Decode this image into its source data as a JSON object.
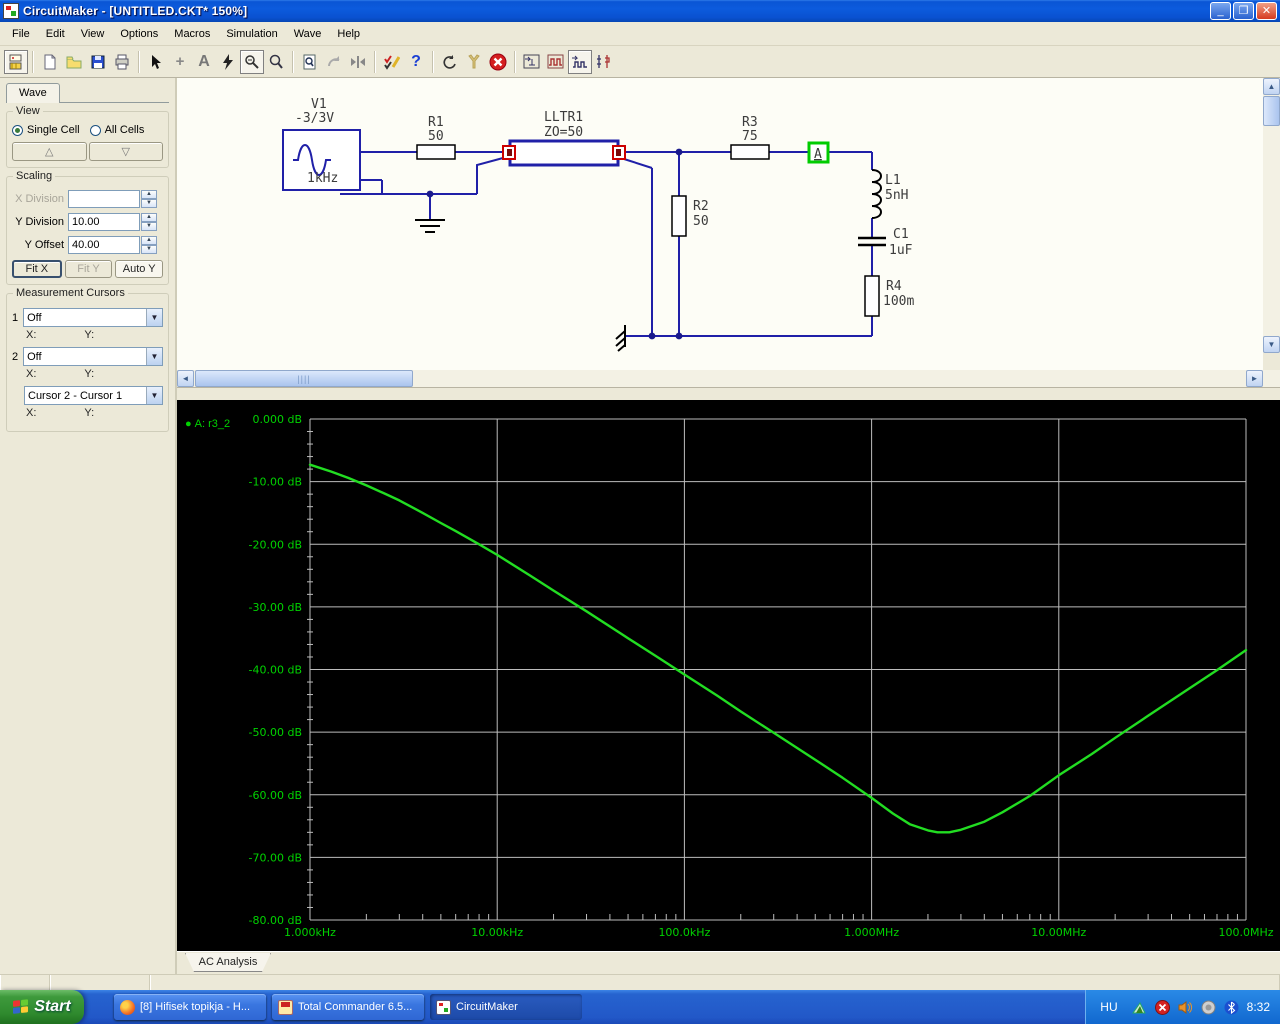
{
  "window": {
    "title": "CircuitMaker - [UNTITLED.CKT* 150%]"
  },
  "menubar": {
    "items": [
      "File",
      "Edit",
      "View",
      "Options",
      "Macros",
      "Simulation",
      "Wave",
      "Help"
    ]
  },
  "toolbar": {
    "icons": [
      "part-browser",
      "new-document",
      "open-file",
      "save-file",
      "print",
      "select-arrow",
      "wire-plus",
      "text-tool",
      "run-simulation",
      "probe-tool",
      "zoom-tool",
      "zoom-page",
      "rotate",
      "split-view",
      "edit-checks",
      "help",
      "undo",
      "utility-wrench",
      "stop-simulation",
      "wave-step",
      "wave-pulse",
      "wave-pulse-run",
      "wave-dual"
    ]
  },
  "wave_panel": {
    "tab_label": "Wave",
    "view": {
      "legend": "View",
      "single_cell": "Single Cell",
      "all_cells": "All Cells",
      "up_glyph": "△",
      "down_glyph": "▽"
    },
    "scaling": {
      "legend": "Scaling",
      "x_division_label": "X Division",
      "x_division_value": "",
      "y_division_label": "Y Division",
      "y_division_value": "10.00",
      "y_offset_label": "Y Offset",
      "y_offset_value": "40.00",
      "fit_x": "Fit X",
      "fit_y": "Fit Y",
      "auto_y": "Auto Y"
    },
    "cursors": {
      "legend": "Measurement Cursors",
      "cursor1_num": "1",
      "cursor1_value": "Off",
      "cursor2_num": "2",
      "cursor2_value": "Off",
      "diff_value": "Cursor 2 - Cursor 1",
      "x_label": "X:",
      "y_label": "Y:"
    }
  },
  "circuit": {
    "v1": {
      "name": "V1",
      "value": "-3/3V",
      "freq": "1kHz"
    },
    "r1": {
      "name": "R1",
      "value": "50"
    },
    "tline": {
      "name": "LLTR1",
      "value": "ZO=50"
    },
    "r2": {
      "name": "R2",
      "value": "50"
    },
    "r3": {
      "name": "R3",
      "value": "75"
    },
    "probe": {
      "label": "A"
    },
    "l1": {
      "name": "L1",
      "value": "5nH"
    },
    "c1": {
      "name": "C1",
      "value": "1uF"
    },
    "r4": {
      "name": "R4",
      "value": "100m"
    }
  },
  "plot": {
    "tab_label": "AC Analysis"
  },
  "chart_data": {
    "type": "line",
    "title": "AC Analysis - magnitude response at probe A (r3_2)",
    "x_scale": "log",
    "x_range_hz": [
      1000,
      100000000
    ],
    "y_range_db": [
      -80,
      0
    ],
    "grid": true,
    "axis_color": "#00d200",
    "grid_color": "#bdbdbd",
    "trace": {
      "name": "A: r3_2",
      "color": "#22dd22"
    },
    "x_ticks": [
      {
        "hz": 1000,
        "label": "1.000kHz"
      },
      {
        "hz": 10000,
        "label": "10.00kHz"
      },
      {
        "hz": 100000,
        "label": "100.0kHz"
      },
      {
        "hz": 1000000,
        "label": "1.000MHz"
      },
      {
        "hz": 10000000,
        "label": "10.00MHz"
      },
      {
        "hz": 100000000,
        "label": "100.0MHz"
      }
    ],
    "y_ticks": [
      {
        "db": 0,
        "label": "0.000 dB"
      },
      {
        "db": -10,
        "label": "-10.00 dB"
      },
      {
        "db": -20,
        "label": "-20.00 dB"
      },
      {
        "db": -30,
        "label": "-30.00 dB"
      },
      {
        "db": -40,
        "label": "-40.00 dB"
      },
      {
        "db": -50,
        "label": "-50.00 dB"
      },
      {
        "db": -60,
        "label": "-60.00 dB"
      },
      {
        "db": -70,
        "label": "-70.00 dB"
      },
      {
        "db": -80,
        "label": "-80.00 dB"
      }
    ],
    "points": [
      [
        1000,
        -7.3
      ],
      [
        1300,
        -8.4
      ],
      [
        1600,
        -9.4
      ],
      [
        2000,
        -10.6
      ],
      [
        2500,
        -11.9
      ],
      [
        3000,
        -13.0
      ],
      [
        4000,
        -15.0
      ],
      [
        5000,
        -16.6
      ],
      [
        6000,
        -17.9
      ],
      [
        8000,
        -20.0
      ],
      [
        10000,
        -21.7
      ],
      [
        15000,
        -25.0
      ],
      [
        20000,
        -27.4
      ],
      [
        30000,
        -30.7
      ],
      [
        50000,
        -35.0
      ],
      [
        70000,
        -37.8
      ],
      [
        100000,
        -40.8
      ],
      [
        150000,
        -44.2
      ],
      [
        200000,
        -46.7
      ],
      [
        300000,
        -50.1
      ],
      [
        500000,
        -54.4
      ],
      [
        700000,
        -57.3
      ],
      [
        1000000,
        -60.5
      ],
      [
        1300000,
        -63.0
      ],
      [
        1600000,
        -64.7
      ],
      [
        2000000,
        -65.7
      ],
      [
        2250000,
        -66.0
      ],
      [
        2600000,
        -66.0
      ],
      [
        3000000,
        -65.6
      ],
      [
        4000000,
        -64.3
      ],
      [
        5000000,
        -62.8
      ],
      [
        7000000,
        -60.2
      ],
      [
        10000000,
        -56.9
      ],
      [
        15000000,
        -53.5
      ],
      [
        20000000,
        -50.9
      ],
      [
        30000000,
        -47.4
      ],
      [
        50000000,
        -43.0
      ],
      [
        70000000,
        -40.1
      ],
      [
        100000000,
        -36.9
      ]
    ]
  },
  "taskbar": {
    "start_label": "Start",
    "tasks": [
      {
        "label": "[8] Hifisek topikja - H...",
        "active": false
      },
      {
        "label": "Total Commander 6.5...",
        "active": false
      },
      {
        "label": "CircuitMaker",
        "active": true
      }
    ],
    "tray": {
      "language": "HU",
      "time": "8:32",
      "icons": [
        "graph-tray-icon",
        "security-shield-icon",
        "volume-icon",
        "gray-device-icon",
        "bluetooth-icon"
      ]
    }
  }
}
